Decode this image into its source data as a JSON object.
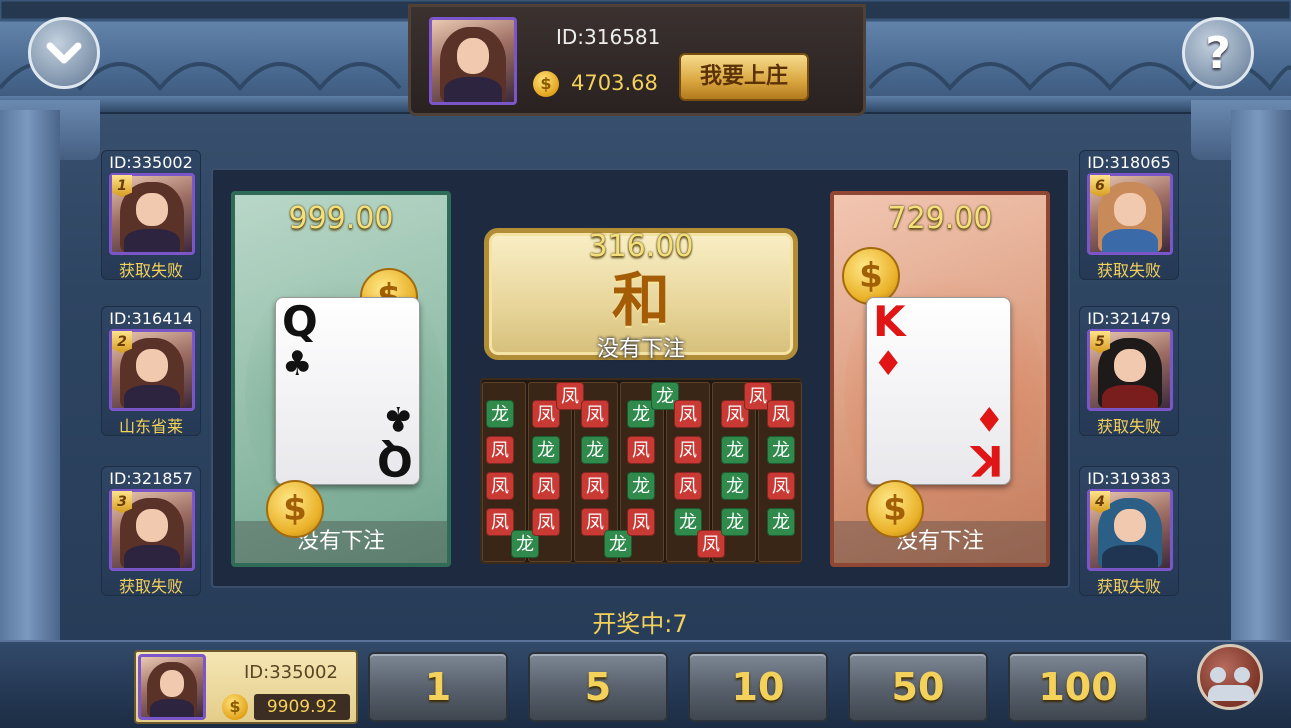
{
  "banker": {
    "id": "ID:316581",
    "gold": "4703.68",
    "apply_button": "我要上庄"
  },
  "icons": {
    "collapse": "chevron-down-icon",
    "help": "question-mark-icon",
    "coin": "$",
    "players": "players-icon"
  },
  "left_players": [
    {
      "id": "ID:335002",
      "rank": "1",
      "status": "获取失败"
    },
    {
      "id": "ID:316414",
      "rank": "2",
      "status": "山东省莱"
    },
    {
      "id": "ID:321857",
      "rank": "3",
      "status": "获取失败"
    }
  ],
  "right_players": [
    {
      "id": "ID:318065",
      "rank": "6",
      "status": "获取失败"
    },
    {
      "id": "ID:321479",
      "rank": "5",
      "status": "获取失败"
    },
    {
      "id": "ID:319383",
      "rank": "4",
      "status": "获取失败"
    }
  ],
  "zones": {
    "dragon": {
      "amount": "999.00",
      "status": "没有下注",
      "card_rank": "Q",
      "card_suit": "♣"
    },
    "tie": {
      "amount": "316.00",
      "label": "和",
      "status": "没有下注"
    },
    "phoenix": {
      "amount": "729.00",
      "status": "没有下注",
      "card_rank": "K",
      "card_suit": "♦"
    }
  },
  "road_labels": {
    "dragon": "龙",
    "phoenix": "凤"
  },
  "countdown": "开奖中:7",
  "me": {
    "id": "ID:335002",
    "gold": "9909.92"
  },
  "chips": [
    "1",
    "5",
    "10",
    "50",
    "100"
  ],
  "colors": {
    "dragon": "#2f8a4b",
    "phoenix": "#c93a34",
    "gold_text": "#f4d15a"
  }
}
